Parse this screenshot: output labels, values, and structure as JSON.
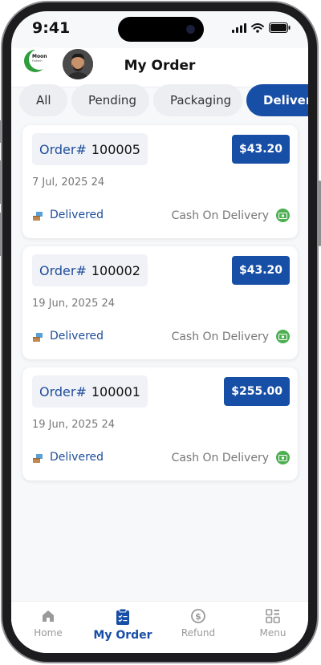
{
  "status_bar": {
    "time": "9:41"
  },
  "header": {
    "logo_text": "Moon",
    "logo_subtext": "Fintech",
    "title": "My Order"
  },
  "tabs": [
    {
      "label": "All",
      "active": false
    },
    {
      "label": "Pending",
      "active": false
    },
    {
      "label": "Packaging",
      "active": false
    },
    {
      "label": "Delivered",
      "active": true
    }
  ],
  "orders": [
    {
      "prefix": "Order#",
      "number": "100005",
      "price": "$43.20",
      "date": "7 Jul, 2025 24",
      "status": "Delivered",
      "payment": "Cash On Delivery"
    },
    {
      "prefix": "Order#",
      "number": "100002",
      "price": "$43.20",
      "date": "19 Jun, 2025 24",
      "status": "Delivered",
      "payment": "Cash On Delivery"
    },
    {
      "prefix": "Order#",
      "number": "100001",
      "price": "$255.00",
      "date": "19 Jun, 2025 24",
      "status": "Delivered",
      "payment": "Cash On Delivery"
    }
  ],
  "bottom_nav": [
    {
      "label": "Home",
      "icon": "home-icon",
      "active": false
    },
    {
      "label": "My Order",
      "icon": "clipboard-icon",
      "active": true
    },
    {
      "label": "Refund",
      "icon": "refund-icon",
      "active": false
    },
    {
      "label": "Menu",
      "icon": "menu-grid-icon",
      "active": false
    }
  ],
  "colors": {
    "primary": "#174ea6",
    "accent_text": "#1f4d99",
    "cash_green": "#4caf50",
    "background": "#f7f8fa"
  }
}
